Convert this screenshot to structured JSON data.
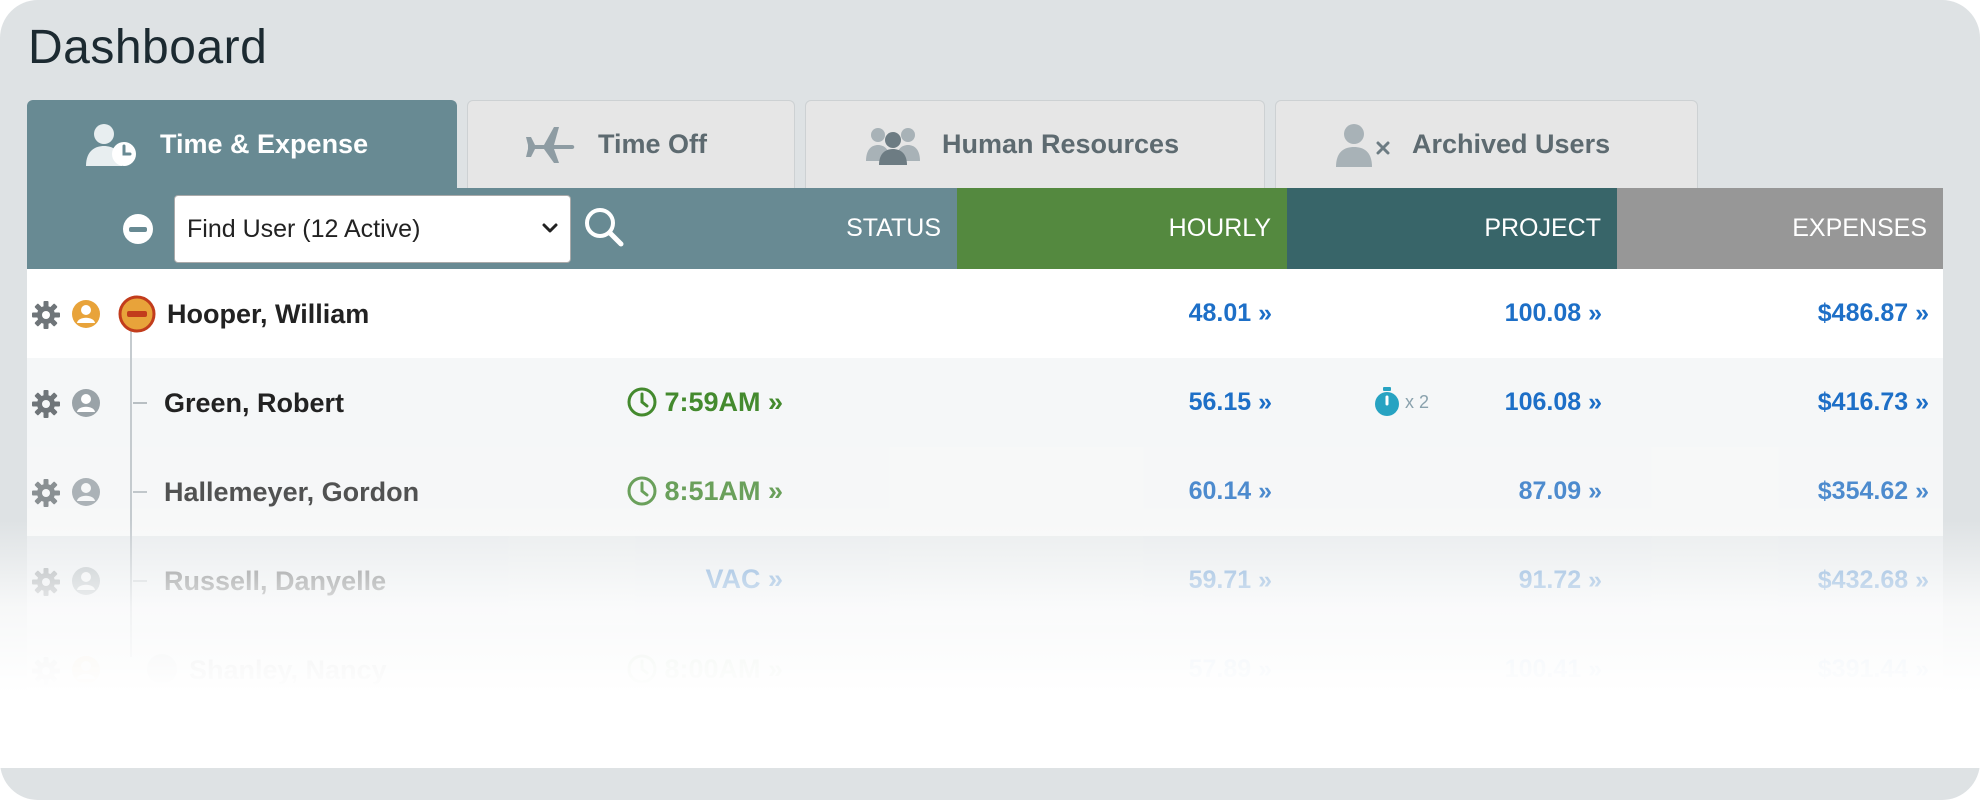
{
  "page": {
    "title": "Dashboard"
  },
  "tabs": [
    {
      "label": "Time & Expense",
      "icon": "user-clock-icon",
      "active": true
    },
    {
      "label": "Time Off",
      "icon": "airplane-icon",
      "active": false
    },
    {
      "label": "Human Resources",
      "icon": "group-icon",
      "active": false
    },
    {
      "label": "Archived Users",
      "icon": "user-remove-icon",
      "active": false
    }
  ],
  "header": {
    "find_user": "Find User (12 Active)",
    "status": "STATUS",
    "hourly": "HOURLY",
    "project": "PROJECT",
    "expenses": "EXPENSES"
  },
  "rows": [
    {
      "name": "Hooper, William",
      "status": "",
      "hourly": "48.01 »",
      "project": "100.08 »",
      "expenses": "$486.87 »"
    },
    {
      "name": "Green, Robert",
      "status": "7:59AM »",
      "hourly": "56.15 »",
      "project_badge": "x 2",
      "project": "106.08 »",
      "expenses": "$416.73 »"
    },
    {
      "name": "Hallemeyer, Gordon",
      "status": "8:51AM »",
      "hourly": "60.14 »",
      "project": "87.09 »",
      "expenses": "$354.62 »"
    },
    {
      "name": "Russell, Danyelle",
      "status": "VAC »",
      "hourly": "59.71 »",
      "project": "91.72 »",
      "expenses": "$432.68 »"
    },
    {
      "name": "Shanley, Nancy",
      "status": "8:00AM »",
      "hourly": "57.89 »",
      "project": "100.41 »",
      "expenses": "$391.44 »"
    }
  ],
  "colors": {
    "tab_active": "#688a93",
    "hourly_header": "#54893f",
    "project_header": "#386569",
    "expenses_header": "#979797",
    "link_blue": "#1d6fc7",
    "status_green": "#448a2e",
    "lead_icon": "#e8a33a"
  }
}
